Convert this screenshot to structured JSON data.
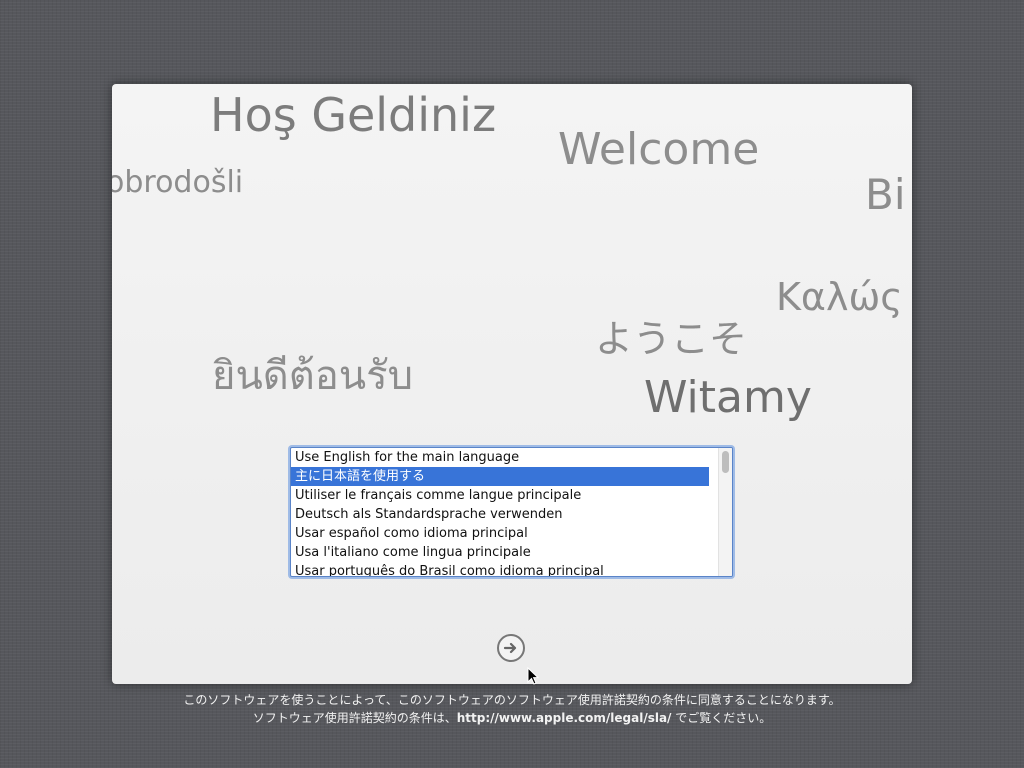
{
  "greetings": [
    {
      "id": "turkish",
      "text": "Hoş Geldiniz"
    },
    {
      "id": "english",
      "text": "Welcome"
    },
    {
      "id": "croatian",
      "text": "obrodošli"
    },
    {
      "id": "italian",
      "text": "Bi"
    },
    {
      "id": "greek",
      "text": "Καλώς"
    },
    {
      "id": "japanese",
      "text": "ようこそ"
    },
    {
      "id": "thai",
      "text": "ยินดีต้อนรับ"
    },
    {
      "id": "polish",
      "text": "Witamy"
    }
  ],
  "language_list": {
    "items": [
      {
        "label": "Use English for the main language",
        "selected": false
      },
      {
        "label": "主に日本語を使用する",
        "selected": true
      },
      {
        "label": "Utiliser le français comme langue principale",
        "selected": false
      },
      {
        "label": "Deutsch als Standardsprache verwenden",
        "selected": false
      },
      {
        "label": "Usar español como idioma principal",
        "selected": false
      },
      {
        "label": "Usa l'italiano come lingua principale",
        "selected": false
      },
      {
        "label": "Usar português do Brasil como idioma principal",
        "selected": false
      }
    ]
  },
  "next_button": {
    "icon": "arrow-right-icon"
  },
  "footer": {
    "line1": "このソフトウェアを使うことによって、このソフトウェアのソフトウェア使用許諾契約の条件に同意することになります。",
    "line2_prefix": "ソフトウェア使用許諾契約の条件は、",
    "line2_url": "http://www.apple.com/legal/sla/",
    "line2_suffix": " でご覧ください。"
  },
  "colors": {
    "selection": "#3874d8",
    "background": "#56575c",
    "greeting_text": "#8d8d8d"
  }
}
